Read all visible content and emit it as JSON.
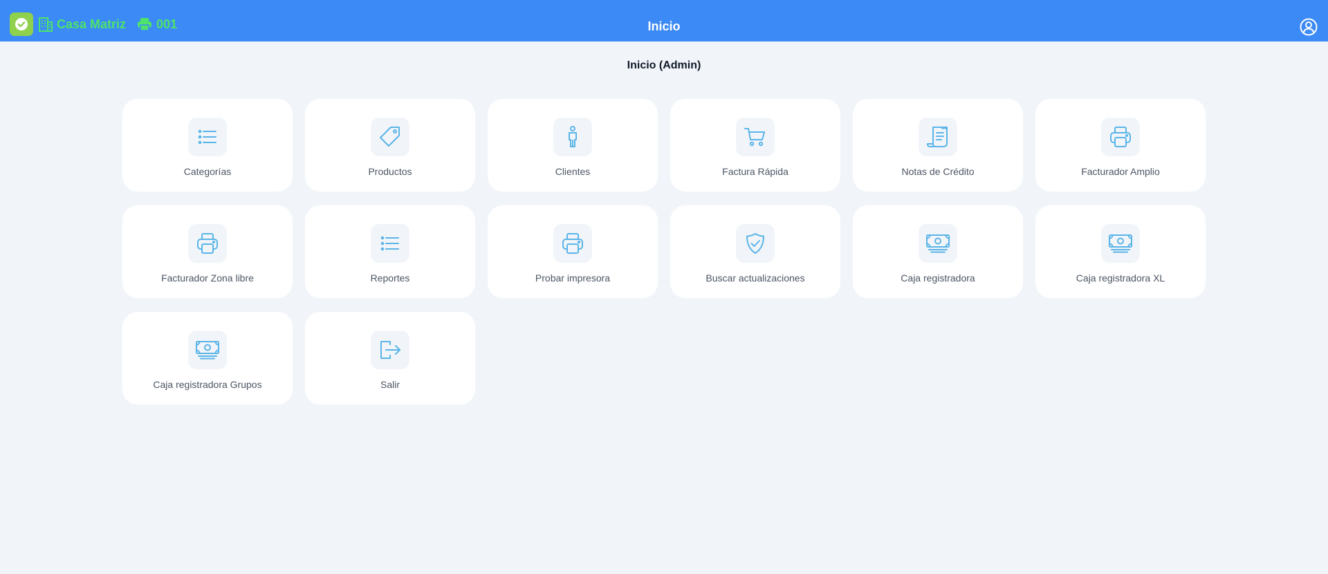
{
  "header": {
    "branch_name": "Casa Matriz",
    "register_number": "001",
    "title": "Inicio",
    "colors": {
      "bar": "#3b8af5",
      "accent_green": "#4ee36a",
      "logo_bg": "#8fd04c"
    }
  },
  "main": {
    "heading": "Inicio (Admin)",
    "tiles": [
      {
        "label": "Categorías",
        "icon": "list-icon"
      },
      {
        "label": "Productos",
        "icon": "tag-icon"
      },
      {
        "label": "Clientes",
        "icon": "person-icon"
      },
      {
        "label": "Factura Rápida",
        "icon": "cart-icon"
      },
      {
        "label": "Notas de Crédito",
        "icon": "receipt-icon"
      },
      {
        "label": "Facturador Amplio",
        "icon": "printer-icon"
      },
      {
        "label": "Facturador Zona libre",
        "icon": "printer-icon"
      },
      {
        "label": "Reportes",
        "icon": "list-icon"
      },
      {
        "label": "Probar impresora",
        "icon": "printer-icon"
      },
      {
        "label": "Buscar actualizaciones",
        "icon": "shield-check-icon"
      },
      {
        "label": "Caja registradora",
        "icon": "cash-icon"
      },
      {
        "label": "Caja registradora XL",
        "icon": "cash-icon"
      },
      {
        "label": "Caja registradora Grupos",
        "icon": "cash-icon"
      },
      {
        "label": "Salir",
        "icon": "logout-icon"
      }
    ],
    "colors": {
      "icon_stroke": "#5ab4e8",
      "tile_bg": "#ffffff",
      "icon_bg": "#f1f5f9"
    }
  }
}
